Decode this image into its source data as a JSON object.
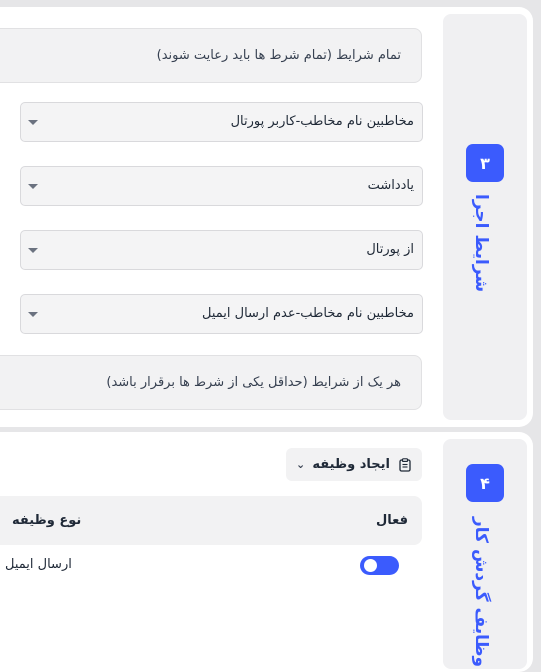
{
  "colors": {
    "accent": "#3b5bfd",
    "panel": "#f2f2f3",
    "background": "#e6e6e8"
  },
  "steps": [
    {
      "number": "۳",
      "title": "شرایط اجرا"
    },
    {
      "number": "۴",
      "title": "وظایف گردش کار"
    }
  ],
  "conditions": {
    "all_label": "تمام شرایط (تمام شرط ها باید رعایت شوند)",
    "selects": [
      {
        "value": "مخاطبین نام مخاطب-کاربر پورتال"
      },
      {
        "value": "یادداشت"
      },
      {
        "value": "از پورتال"
      },
      {
        "value": "مخاطبین نام مخاطب-عدم ارسال ایمیل"
      }
    ],
    "any_label": "هر یک از شرایط (حداقل یکی از شرط ها برقرار باشد)"
  },
  "tasks": {
    "create_button": "ایجاد وظیفه",
    "create_icon": "clipboard-icon",
    "columns": {
      "active": "فعال",
      "type": "نوع وظیفه"
    },
    "rows": [
      {
        "active": true,
        "type": "ارسال ایمیل"
      }
    ]
  }
}
